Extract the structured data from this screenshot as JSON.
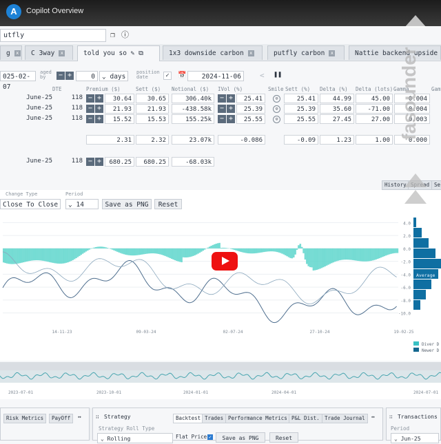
{
  "window": {
    "title": "Copilot Overview",
    "logo_letter": "A"
  },
  "search": {
    "value": "utfly"
  },
  "tabs": [
    "g",
    "C 3way",
    "told you so",
    "1x3 downside carbon",
    "putfly carbon",
    "Nattie backend upside"
  ],
  "params": {
    "date_from": "025-02-07",
    "aged_by_label": "aged by",
    "aged_by_value": "0",
    "aged_by_unit": "days",
    "position_date_label": "position date",
    "position_date": "2024-11-06"
  },
  "grid": {
    "headers": [
      "DTE",
      "Premium ($)",
      "Sett ($)",
      "Notional ($)",
      "IVol (%)",
      "Smile",
      "Sett (%)",
      "Delta (%)",
      "Delta (lots)",
      "Gamma",
      "Gam"
    ],
    "rows": [
      {
        "expiry": "June-25",
        "dte": "118",
        "premium": "30.64",
        "sett": "30.65",
        "notional": "306.40k",
        "ivol": "25.41",
        "sett_pct": "25.41",
        "delta_pct": "44.99",
        "delta_lots": "45.00",
        "gamma": "0.004"
      },
      {
        "expiry": "June-25",
        "dte": "118",
        "premium": "21.93",
        "sett": "21.93",
        "notional": "-438.58k",
        "ivol": "25.39",
        "sett_pct": "25.39",
        "delta_pct": "35.60",
        "delta_lots": "-71.00",
        "gamma": "0.004"
      },
      {
        "expiry": "June-25",
        "dte": "118",
        "premium": "15.52",
        "sett": "15.53",
        "notional": "155.25k",
        "ivol": "25.55",
        "sett_pct": "25.55",
        "delta_pct": "27.45",
        "delta_lots": "27.00",
        "gamma": "0.003"
      }
    ],
    "totals": {
      "premium": "2.31",
      "sett": "2.32",
      "notional": "23.07k",
      "ivol": "-0.086",
      "sett_pct": "-0.09",
      "delta_pct": "1.23",
      "delta_lots": "1.00",
      "gamma": "0.000"
    },
    "underlying": {
      "expiry": "June-25",
      "dte": "118",
      "premium": "680.25",
      "sett": "680.25",
      "notional": "-68.03k"
    }
  },
  "right_tabs": [
    "History",
    "Spread",
    "Se"
  ],
  "chart_controls": {
    "change_type_label": "Change Type",
    "change_type_value": "Close To Close",
    "period_label": "Period",
    "period_value": "14",
    "save_label": "Save as PNG",
    "reset_label": "Reset"
  },
  "chart_data": {
    "type": "area",
    "x_ticks": [
      "14-11-23",
      "09-03-24",
      "02-07-24",
      "27-10-24",
      "19-02-25"
    ],
    "y_ticks": [
      "4.0",
      "2.0",
      "0.0",
      "-2.0",
      "-4.0",
      "-6.0",
      "-8.0",
      "-10.0"
    ],
    "ylim": [
      -11,
      5
    ],
    "side_label": "Average",
    "legend": [
      "Diver D",
      "Newer D"
    ],
    "colors": {
      "area": "#5fd6cc",
      "line": "#4e6e8e",
      "hist": "#0f6fa2"
    }
  },
  "navigator": {
    "x_ticks": [
      "2023-07-01",
      "2023-10-01",
      "2024-01-01",
      "2024-04-01",
      "2024-07-01"
    ]
  },
  "bottom": {
    "left_tabs": [
      "Risk Metrics",
      "PayOff"
    ],
    "strategy_title": "Strategy",
    "strategy_tabs": [
      "Backtest",
      "Trades",
      "Performance Metrics",
      "P&L Dist.",
      "Trade Journal"
    ],
    "roll_type_label": "Strategy Roll Type",
    "roll_type_value": "Rolling",
    "flat_price_label": "Flat Price",
    "save_label": "Save as PNG",
    "reset_label": "Reset",
    "transactions_title": "Transactions",
    "period_label": "Period",
    "period_value": "Jun-25"
  },
  "watermark": "fasounder"
}
